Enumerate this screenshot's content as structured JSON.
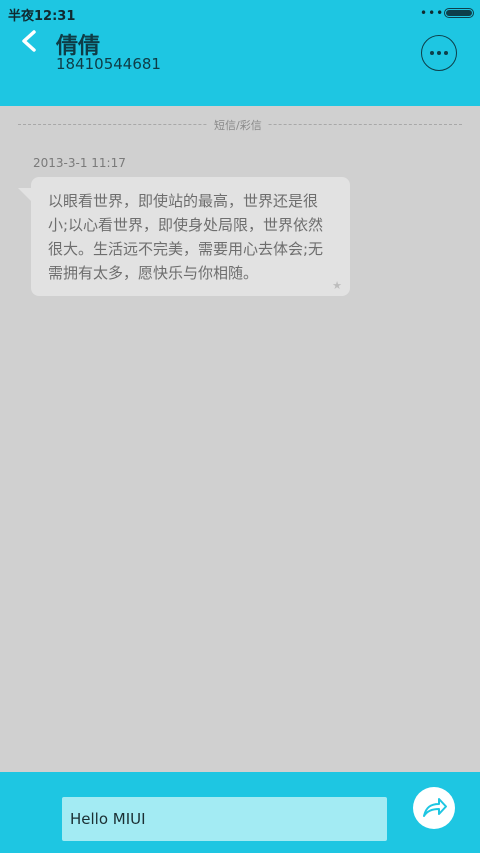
{
  "status_bar": {
    "time": "半夜12:31",
    "more_dots": "•••"
  },
  "header": {
    "contact_name": "倩倩",
    "contact_number": "18410544681",
    "accent_color": "#1ec6e2"
  },
  "icons": {
    "back": "chevron-left-icon",
    "more": "more-dots-icon",
    "send": "send-arrow-icon"
  },
  "conversation": {
    "divider_label": "短信/彩信",
    "messages": [
      {
        "timestamp": "2013-3-1 11:17",
        "text": "以眼看世界，即使站的最高，世界还是很小;以心看世界，即使身处局限，世界依然很大。生活远不完美，需要用心去体会;无需拥有太多，愿快乐与你相随。",
        "star": "★"
      }
    ]
  },
  "composer": {
    "value": "Hello MIUI"
  }
}
